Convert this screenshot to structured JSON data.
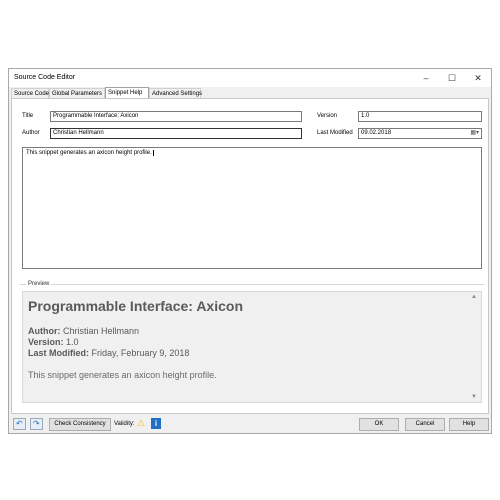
{
  "window": {
    "title": "Source Code Editor",
    "controls": {
      "minimize": "–",
      "maximize": "☐",
      "close": "✕"
    }
  },
  "tabs": [
    {
      "label": "Source Code",
      "active": false
    },
    {
      "label": "Global Parameters",
      "active": false
    },
    {
      "label": "Snippet Help",
      "active": true
    },
    {
      "label": "Advanced Settings",
      "active": false
    }
  ],
  "form": {
    "title_label": "Title",
    "title_value": "Programmable Interface: Axicon",
    "author_label": "Author",
    "author_value": "Christian Hellmann",
    "version_label": "Version",
    "version_value": "1.0",
    "modified_label": "Last Modified",
    "modified_value": "09.02.2018",
    "description": "This snippet generates an axicon height profile."
  },
  "preview": {
    "group_label": "Preview",
    "heading": "Programmable Interface: Axicon",
    "author_key": "Author:",
    "author_value": " Christian Hellmann",
    "version_key": "Version:",
    "version_value": " 1.0",
    "modified_key": "Last Modified:",
    "modified_value": " Friday, February 9, 2018",
    "description": "This snippet generates an axicon height profile."
  },
  "footer": {
    "check_button": "Check Consistency",
    "validity_label": "Validity:",
    "ok": "OK",
    "cancel": "Cancel",
    "help": "Help"
  },
  "colors": {
    "accent": "#1f6fc5",
    "warning": "#f5c400"
  }
}
